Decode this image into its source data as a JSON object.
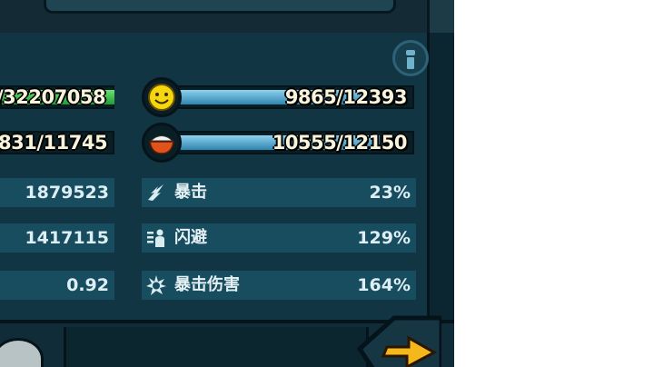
{
  "colors": {
    "panel_bg": "#123543",
    "row_bg": "#184c5f",
    "bar_fill": "#4aa6d0",
    "hp_bar_fill": "#29c840",
    "text": "#f8f4dc"
  },
  "resource_bars": [
    {
      "icon": "smiley-face-icon",
      "value": "9865/12393",
      "fraction": 0.796
    },
    {
      "icon": "rice-bowl-icon",
      "value": "10555/12150",
      "fraction": 0.869
    }
  ],
  "left_bars": [
    {
      "value": "/32207058"
    },
    {
      "value": "831/11745"
    }
  ],
  "left_stats": [
    {
      "value": "1879523"
    },
    {
      "value": "1417115"
    },
    {
      "value": "0.92"
    }
  ],
  "right_stats": [
    {
      "icon": "crit-claw-icon",
      "label": "暴击",
      "value": "23%"
    },
    {
      "icon": "dodge-figure-icon",
      "label": "闪避",
      "value": "129%"
    },
    {
      "icon": "crit-damage-burst-icon",
      "label": "暴击伤害",
      "value": "164%"
    }
  ],
  "icons": {
    "info": "info-icon",
    "next": "arrow-right-icon"
  }
}
